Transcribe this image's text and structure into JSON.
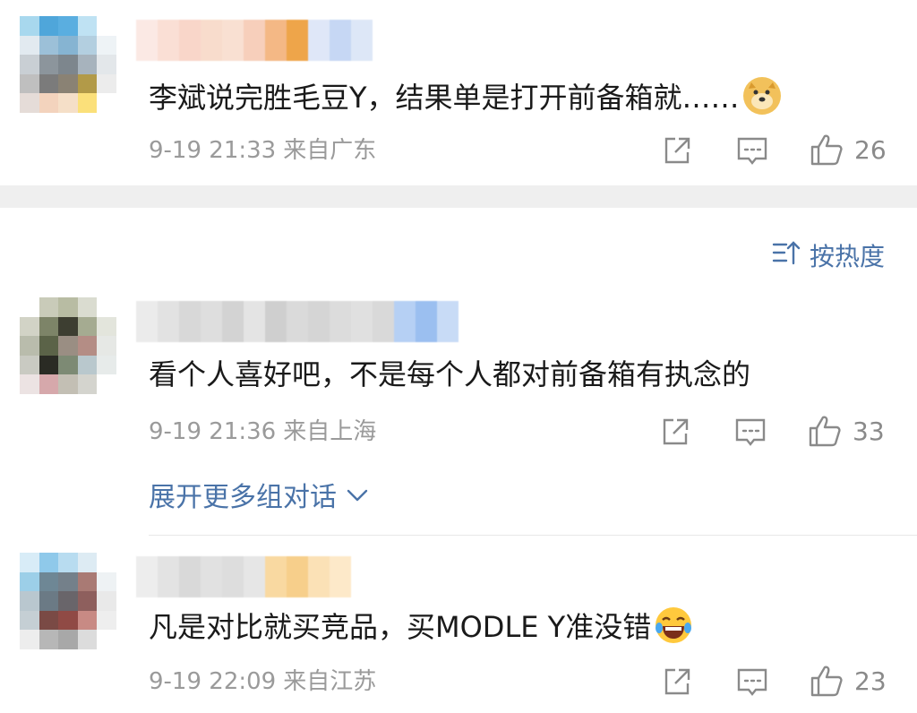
{
  "comments": [
    {
      "text": "李斌说完胜毛豆Y，结果单是打开前备箱就……",
      "emoji": "doge-emoji",
      "time": "9-19 21:33",
      "location": "来自广东",
      "likes": "26"
    },
    {
      "text": "看个人喜好吧，不是每个人都对前备箱有执念的",
      "time": "9-19 21:36",
      "location": "来自上海",
      "likes": "33"
    },
    {
      "text": "凡是对比就买竞品，买MODLE Y准没错",
      "emoji": "laughing-tears-emoji",
      "time": "9-19 22:09",
      "location": "来自江苏",
      "likes": "23"
    }
  ],
  "sort": {
    "label": "按热度",
    "icon": "sort-icon"
  },
  "expand": {
    "label": "展开更多组对话",
    "icon": "chevron-down-icon"
  },
  "colors": {
    "link": "#4a73a8",
    "meta": "#9a9a9a",
    "icon": "#8a8a8a",
    "band": "#efefef"
  }
}
